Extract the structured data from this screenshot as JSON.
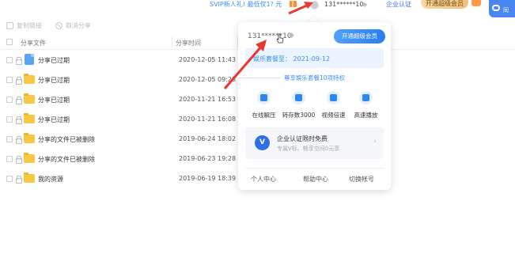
{
  "topbar": {
    "promo": "SVIP新人礼! 最低仅1? 元",
    "username": "131******10",
    "enterprise_link": "企业认证",
    "svip_button": "开通超级会员",
    "corner_text": "同"
  },
  "toolbar": {
    "copy_link": "复制链接",
    "cancel_share": "取消分享"
  },
  "table": {
    "col_name": "分享文件",
    "col_time": "分享时间",
    "rows": [
      {
        "name": "分享已过期",
        "time": "2020-12-05 11:43",
        "icon": "doc-icon"
      },
      {
        "name": "分享已过期",
        "time": "2020-12-05 09:28",
        "icon": "folder-icon"
      },
      {
        "name": "分享已过期",
        "time": "2020-11-21 16:53",
        "icon": "folder-icon"
      },
      {
        "name": "分享已过期",
        "time": "2020-11-21 16:08",
        "icon": "folder-icon"
      },
      {
        "name": "分享的文件已被删除",
        "time": "2019-06-24 18:02",
        "icon": "folder-icon"
      },
      {
        "name": "分享的文件已被删除",
        "time": "2019-06-23 19:28",
        "icon": "folder-icon"
      },
      {
        "name": "我的资源",
        "time": "2019-06-19 18:39",
        "icon": "folder-icon"
      }
    ]
  },
  "popup": {
    "username": "131******10",
    "open_svip": "开通超级会员",
    "membership": "娱乐套餐至： 2021-09-12",
    "privilege_title": "尊享娱乐套餐10项特权",
    "features": [
      {
        "label": "在线解压",
        "icon": "cloud-unzip-icon"
      },
      {
        "label": "转存数3000",
        "icon": "transfer-icon"
      },
      {
        "label": "视频倍速",
        "icon": "video-speed-icon"
      },
      {
        "label": "高速播放",
        "icon": "play-icon"
      }
    ],
    "enterprise": {
      "badge": "V",
      "title": "企业认证限时免费",
      "subtitle": "专属V标、畅享空间0元享"
    },
    "footer": [
      "个人中心",
      "帮助中心",
      "切换帐号"
    ]
  },
  "colors": {
    "accent": "#3b8cf5",
    "annotation_arrow": "#e8372c",
    "folder": "#f7c843"
  }
}
